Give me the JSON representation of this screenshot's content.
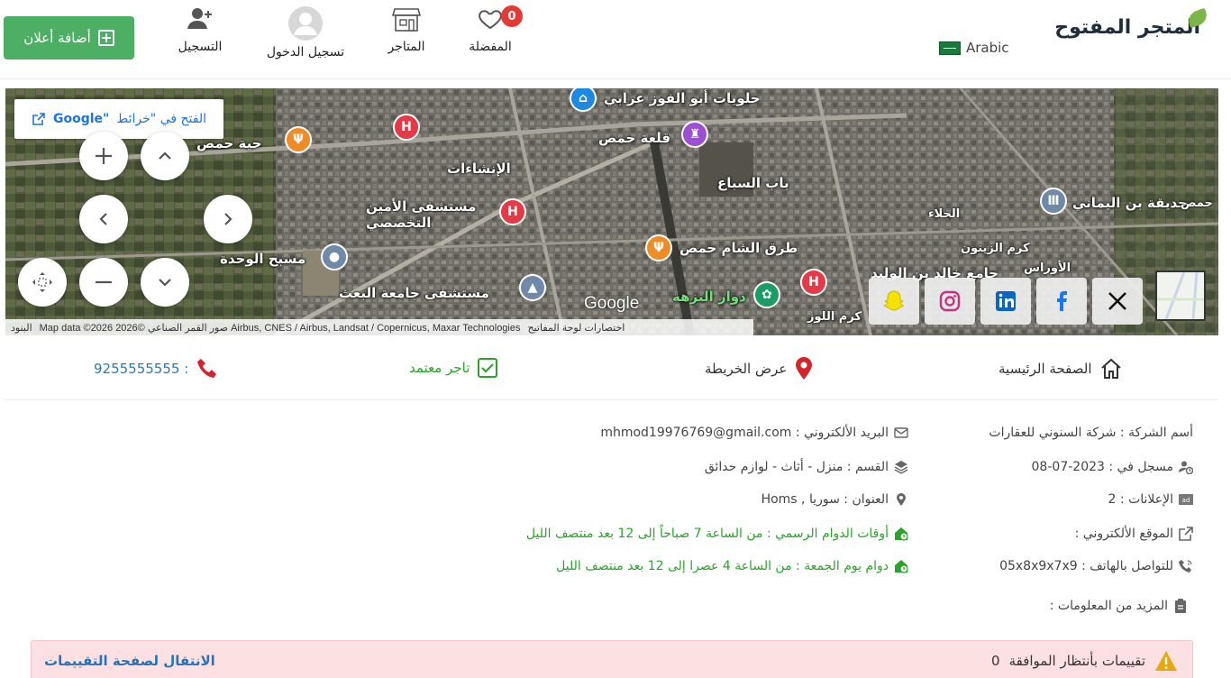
{
  "header": {
    "logo_text": "المتجر المفتوح",
    "language": "Arabic",
    "favorites_label": "المفضلة",
    "favorites_count": "0",
    "stores_label": "المتاجر",
    "login_label": "تسجيل الدخول",
    "register_label": "التسجيل",
    "add_ad_label": "أضافة أعلان"
  },
  "map": {
    "open_in_google_prefix": "الفتح في \"خرائط",
    "open_in_google_brand": "Google\"",
    "google_mark": "Google",
    "attribution_terms": "البنود",
    "attribution_data": "Map data ©2026 2026© صور القمر الصناعي Airbus, CNES / Airbus, Landsat / Copernicus, Maxar Technologies",
    "attribution_shortcuts": "اختصارات لوحة المفاتيح",
    "places": [
      "حلويات أبو الفوز عرابي",
      "قلعة حمص",
      "حية حمص",
      "الإنشاءات",
      "باب السباع",
      "مستشفى الأمين التخصصي",
      "طرق الشام حمص",
      "مسبح الوحدة",
      "مستشفى جامعة البعث",
      "دوار النزهة",
      "جامع خالد بن الوليد",
      "حديقة بن اليماني",
      "كرم الزيتون",
      "الجلاء",
      "الأوراس",
      "كرم اللوز",
      "حمص"
    ],
    "social": [
      "snapchat",
      "instagram",
      "linkedin",
      "facebook",
      "x"
    ]
  },
  "actions": {
    "phone": "9255555555 :",
    "verified": "تاجر معتمد",
    "map_view": "عرض الخريطة",
    "home": "الصفحة الرئيسية"
  },
  "info": {
    "company_label": "أسم الشركة : شركة السنوني للعقارات",
    "registered": "مسجل في : 2023-07-08",
    "ads": "الإعلانات : 2",
    "website": "الموقع الألكتروني :",
    "phone_contact": "للتواصل بالهاتف : 05x8x9x7x9",
    "more_info": "المزيد من المعلومات :",
    "email": "البريد الألكتروني : mhmod19976769@gmail.com",
    "category": "القسم : منزل - أثاث - لوازم حدائق",
    "address": "العنوان : سوريا , Homs",
    "hours": "أوقات الدوام الرسمي : من الساعة 7 صباحاً إلى 12 بعد منتصف الليل",
    "friday_hours": "دوام يوم الجمعة : من الساعة 4 عصرا إلى 12 بعد منتصف الليل"
  },
  "alert": {
    "pending_label": "تقييمات بأنتظار الموافقة",
    "pending_count": "0",
    "reviews_link": "الانتقال لصفحة التقييمات"
  },
  "colors": {
    "accent_green": "#4caf63",
    "badge_red": "#e53935",
    "link_blue": "#2673b8",
    "success_green": "#2aa52a",
    "alert_bg": "#fde1e2"
  }
}
